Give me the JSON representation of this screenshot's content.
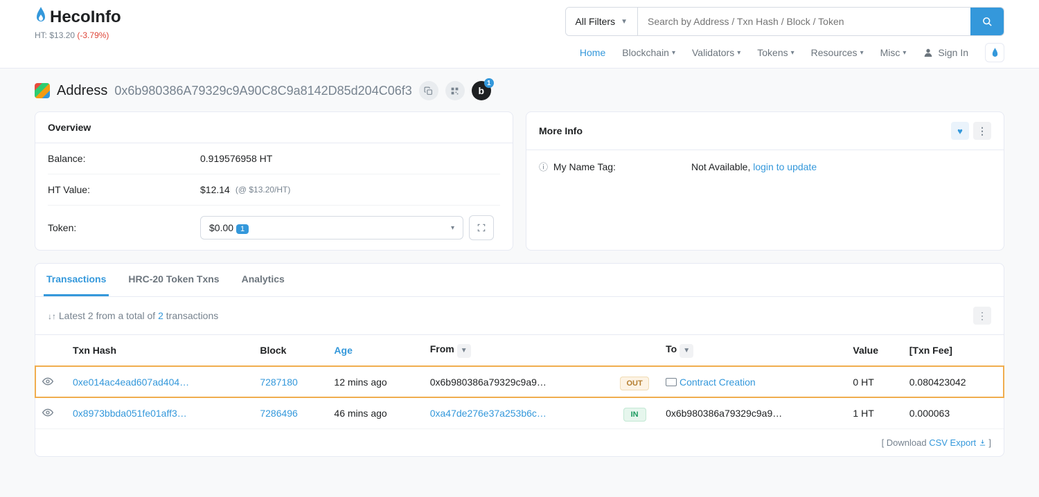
{
  "brand": "HecoInfo",
  "ticker": {
    "label": "HT: ",
    "price": "$13.20",
    "pct": "(-3.79%)"
  },
  "search": {
    "filter": "All Filters",
    "placeholder": "Search by Address / Txn Hash / Block / Token"
  },
  "nav": {
    "home": "Home",
    "blockchain": "Blockchain",
    "validators": "Validators",
    "tokens": "Tokens",
    "resources": "Resources",
    "misc": "Misc",
    "signin": "Sign In"
  },
  "address": {
    "title": "Address",
    "hash": "0x6b980386A79329c9A90C8C9a8142D85d204C06f3"
  },
  "overview": {
    "title": "Overview",
    "balance_label": "Balance:",
    "balance_value": "0.919576958 HT",
    "htvalue_label": "HT Value:",
    "htvalue_value": "$12.14",
    "htvalue_rate": "(@ $13.20/HT)",
    "token_label": "Token:",
    "token_amount": "$0.00",
    "token_count": "1"
  },
  "moreinfo": {
    "title": "More Info",
    "nametag_label": "My Name Tag:",
    "nametag_na": "Not Available, ",
    "nametag_link": "login to update"
  },
  "tabs": {
    "txns": "Transactions",
    "hrc20": "HRC-20 Token Txns",
    "analytics": "Analytics"
  },
  "summary": {
    "pre": "Latest 2 from a total of ",
    "count": "2",
    "post": " transactions"
  },
  "columns": {
    "hash": "Txn Hash",
    "block": "Block",
    "age": "Age",
    "from": "From",
    "to": "To",
    "value": "Value",
    "fee": "[Txn Fee]"
  },
  "txns": [
    {
      "hash": "0xe014ac4ead607ad404…",
      "block": "7287180",
      "age": "12 mins ago",
      "from": "0x6b980386a79329c9a9…",
      "from_link": false,
      "dir": "OUT",
      "to": "Contract Creation",
      "contract": true,
      "value": "0 HT",
      "fee": "0.080423042"
    },
    {
      "hash": "0x8973bbda051fe01aff3…",
      "block": "7286496",
      "age": "46 mins ago",
      "from": "0xa47de276e37a253b6c…",
      "from_link": true,
      "dir": "IN",
      "to": "0x6b980386a79329c9a9…",
      "contract": false,
      "value": "1 HT",
      "fee": "0.000063"
    }
  ],
  "csv": {
    "pre": "[ Download ",
    "link": "CSV Export",
    "post": " ]"
  }
}
